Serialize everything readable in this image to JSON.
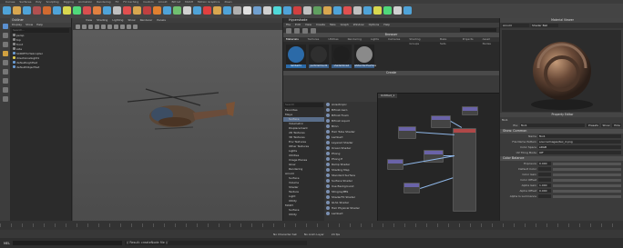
{
  "shelf": {
    "tabs": [
      "Curves",
      "Surfaces",
      "Poly",
      "Sculpting",
      "Rigging",
      "Animation",
      "Rendering",
      "FX",
      "FX Caching",
      "Custom",
      "Arnold",
      "Bifrost",
      "MASH",
      "Motion Graphics",
      "XGen"
    ],
    "icon_colors": [
      "#4fa3d8",
      "#d8a64f",
      "#4fa3d8",
      "#b05050",
      "#d06a30",
      "#4fa3d8",
      "#d8d84f",
      "#4fd87a",
      "#d84f4f",
      "#e08040",
      "#4fa3d8",
      "#c0c0c0",
      "#e04f4f",
      "#d8a64f",
      "#c04040",
      "#e08030",
      "#4fa3d8",
      "#70c070",
      "#d0d0d0",
      "#4fa3d8",
      "#e04040",
      "#d8a64f",
      "#4fa3d8",
      "#b0b0b0",
      "#e0e0e0",
      "#70a0d0",
      "#d0d0d0",
      "#4fd8d8",
      "#4fa3d8",
      "#d04040",
      "#c0c0c0",
      "#60a060",
      "#d8a64f",
      "#4fa3d8",
      "#e05050",
      "#c0c0c0",
      "#4fa3d8",
      "#d8d84f",
      "#4fd87a",
      "#d0d0d0",
      "#4fa3d8"
    ]
  },
  "outliner": {
    "title": "Outliner",
    "menu": [
      "Display",
      "Show",
      "Help"
    ],
    "search_placeholder": "Search...",
    "items": [
      {
        "label": "persp",
        "selected": false
      },
      {
        "label": "top",
        "selected": false
      },
      {
        "label": "front",
        "selected": false
      },
      {
        "label": "side",
        "selected": false
      },
      {
        "label": "SCRIPTS:Helicopter",
        "selected": false
      },
      {
        "label": "directionalLight1",
        "selected": false
      },
      {
        "label": "defaultLightSet",
        "selected": false
      },
      {
        "label": "defaultObjectSet",
        "selected": false
      }
    ]
  },
  "viewport": {
    "menu": [
      "View",
      "Shading",
      "Lighting",
      "Show",
      "Renderer",
      "Panels"
    ]
  },
  "hypershade": {
    "title": "Hypershade",
    "menu": [
      "File",
      "Edit",
      "View",
      "Create",
      "Tabs",
      "Graph",
      "Window",
      "Options",
      "Help"
    ],
    "browser_title": "Browser",
    "browser_tabs": [
      "Materials",
      "Textures",
      "Utilities",
      "Rendering",
      "Lights",
      "Cameras",
      "Shading Groups",
      "Bake Sets",
      "Projects",
      "Asset Nodes"
    ],
    "swatches": [
      {
        "label": "lambert1",
        "color": "#2b6aa8"
      },
      {
        "label": "particleCloud1",
        "color": "#2f2f2f"
      },
      {
        "label": "shaderGlow1",
        "color": "#1f1f1f"
      },
      {
        "label": "aiStandardSurface",
        "color": "#8a8a8a"
      }
    ],
    "create_title": "Create",
    "create_search": "Search",
    "create_categories": [
      "Favorites",
      "Maya",
      "Surface",
      "Volumetric",
      "Displacement",
      "2D Textures",
      "3D Textures",
      "Env Textures",
      "Other Textures",
      "Lights",
      "Utilities",
      "Image Planes",
      "Glow",
      "Rendering",
      "Arnold",
      "Surface",
      "Volume",
      "Shader",
      "Texture",
      "Light",
      "Utility",
      "MASH",
      "Surface",
      "Utility"
    ],
    "create_items": [
      "Anisotropic",
      "Bifrost Aero",
      "Bifrost Foam",
      "Bifrost Liquid",
      "Blinn",
      "Hair Tube Shader",
      "Lambert",
      "Layered Shader",
      "Ocean Shader",
      "Phong",
      "Phong E",
      "Ramp Shader",
      "Shading Map",
      "Standard Surface",
      "Surface Shader",
      "Use Background",
      "StingrayPBS",
      "ShaderFX Shader",
      "GLSL Shader",
      "Hair Physical Shader",
      "Lambert"
    ],
    "graph_tab": "Untitled_1"
  },
  "material_viewer": {
    "title": "Material Viewer",
    "renderer": "Arnold",
    "shape": "Shader Ball"
  },
  "attribute_editor": {
    "title": "Property Editor",
    "node_name": "fbx1",
    "section_show": "Show: Common",
    "fields": [
      {
        "key": "Name",
        "value": "fbx1"
      },
      {
        "key": "File Name Pattern",
        "value": "sourceimages/tex_d.png"
      },
      {
        "key": "Color Space",
        "value": "sRGB"
      },
      {
        "key": "UV Tiling Mode",
        "value": "Off"
      }
    ],
    "section_color": "Color Balance",
    "color_fields": [
      {
        "key": "Exposure",
        "value": "0.000"
      },
      {
        "key": "Default Color",
        "value": ""
      },
      {
        "key": "Color Gain",
        "value": ""
      },
      {
        "key": "Color Offset",
        "value": ""
      },
      {
        "key": "Alpha Gain",
        "value": "1.000"
      },
      {
        "key": "Alpha Offset",
        "value": "0.000"
      },
      {
        "key": "Alpha Is Luminance",
        "value": ""
      }
    ],
    "buttons": [
      "Presets",
      "Show",
      "Hide"
    ]
  },
  "command_line": {
    "mel_label": "MEL",
    "result": "// Result: createNode file //"
  },
  "status": {
    "character_set": "No Character Set",
    "anim_layer": "No Anim Layer",
    "fps": "24 fps"
  }
}
